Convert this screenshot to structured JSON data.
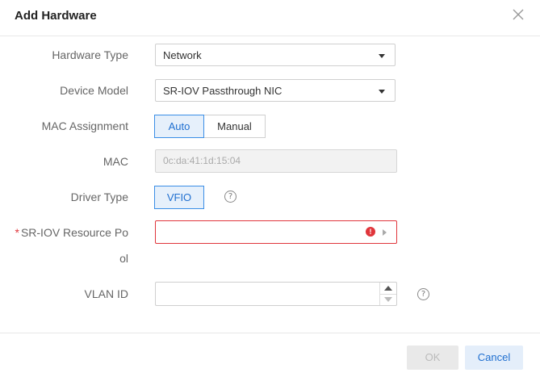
{
  "dialog": {
    "title": "Add Hardware",
    "close_icon": "close-icon"
  },
  "form": {
    "hardware_type": {
      "label": "Hardware Type",
      "value": "Network"
    },
    "device_model": {
      "label": "Device Model",
      "value": "SR-IOV Passthrough NIC"
    },
    "mac_assignment": {
      "label": "MAC Assignment",
      "options": [
        "Auto",
        "Manual"
      ],
      "selected": "Auto"
    },
    "mac": {
      "label": "MAC",
      "value": "0c:da:41:1d:15:04"
    },
    "driver_type": {
      "label": "Driver Type",
      "options": [
        "VFIO"
      ],
      "selected": "VFIO",
      "help_icon": "?"
    },
    "sriov_pool": {
      "required_mark": "*",
      "label_line1": "SR-IOV Resource Po",
      "label_line2": "ol",
      "value": "",
      "error_icon": "!"
    },
    "vlan_id": {
      "label": "VLAN ID",
      "value": "",
      "help_icon": "?"
    }
  },
  "footer": {
    "ok_label": "OK",
    "cancel_label": "Cancel"
  },
  "colors": {
    "accent": "#1f6fd0",
    "error": "#e0353b",
    "active_bg": "#e6f0fb"
  }
}
